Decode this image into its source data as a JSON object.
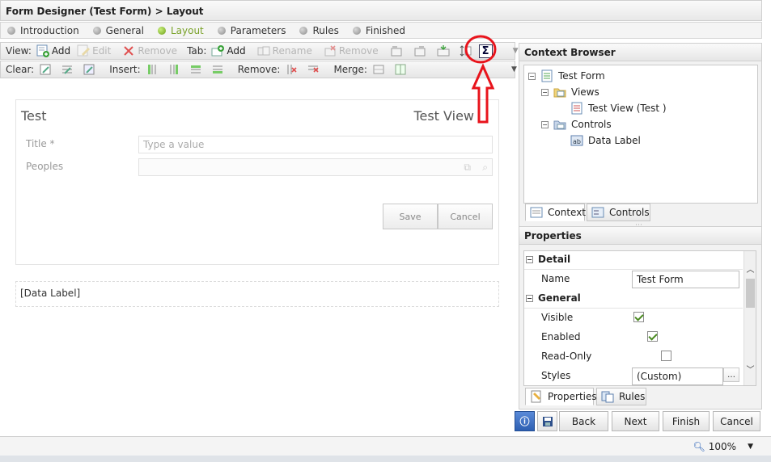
{
  "title": "Form Designer (Test Form) > Layout",
  "steps": [
    "Introduction",
    "General",
    "Layout",
    "Parameters",
    "Rules",
    "Finished"
  ],
  "toolbar1": {
    "view_label": "View:",
    "add": "Add",
    "edit": "Edit",
    "remove": "Remove",
    "tab_label": "Tab:",
    "tab_add": "Add",
    "rename": "Rename",
    "tab_remove": "Remove"
  },
  "toolbar2": {
    "clear_label": "Clear:",
    "insert_label": "Insert:",
    "remove_label": "Remove:",
    "merge_label": "Merge:"
  },
  "view": {
    "title": "Test",
    "view_name": "Test View",
    "title_label": "Title *",
    "title_placeholder": "Type a value",
    "peoples_label": "Peoples",
    "save": "Save",
    "cancel": "Cancel"
  },
  "datalabel": "[Data Label]",
  "context": {
    "header": "Context Browser",
    "root": "Test Form",
    "views": "Views",
    "view_item": "Test View (Test )",
    "controls": "Controls",
    "control_item": "Data Label",
    "tab_context": "Context",
    "tab_controls": "Controls"
  },
  "properties": {
    "header": "Properties",
    "detail": "Detail",
    "name_label": "Name",
    "name_value": "Test Form",
    "general": "General",
    "visible": "Visible",
    "enabled": "Enabled",
    "readonly": "Read-Only",
    "styles": "Styles",
    "styles_value": "(Custom)",
    "tab_properties": "Properties",
    "tab_rules": "Rules",
    "visible_checked": true,
    "enabled_checked": true,
    "readonly_checked": false
  },
  "nav": {
    "back": "Back",
    "next": "Next",
    "finish": "Finish",
    "cancel": "Cancel"
  },
  "status": {
    "zoom": "100%"
  },
  "colors": {
    "annotation": "#e8141c",
    "active_step": "#7aa22a"
  },
  "annotation": {
    "circle_target": "sum-icon",
    "arrow": "up-arrow"
  }
}
